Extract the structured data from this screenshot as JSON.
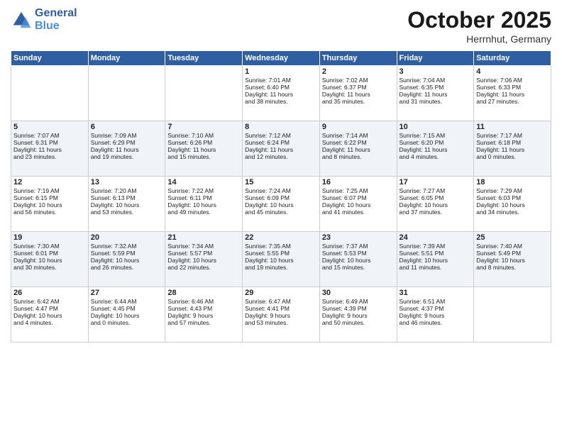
{
  "header": {
    "logo_line1": "General",
    "logo_line2": "Blue",
    "month": "October 2025",
    "location": "Herrnhut, Germany"
  },
  "days_of_week": [
    "Sunday",
    "Monday",
    "Tuesday",
    "Wednesday",
    "Thursday",
    "Friday",
    "Saturday"
  ],
  "weeks": [
    [
      {
        "day": "",
        "info": ""
      },
      {
        "day": "",
        "info": ""
      },
      {
        "day": "",
        "info": ""
      },
      {
        "day": "1",
        "info": "Sunrise: 7:01 AM\nSunset: 6:40 PM\nDaylight: 11 hours\nand 38 minutes."
      },
      {
        "day": "2",
        "info": "Sunrise: 7:02 AM\nSunset: 6:37 PM\nDaylight: 11 hours\nand 35 minutes."
      },
      {
        "day": "3",
        "info": "Sunrise: 7:04 AM\nSunset: 6:35 PM\nDaylight: 11 hours\nand 31 minutes."
      },
      {
        "day": "4",
        "info": "Sunrise: 7:06 AM\nSunset: 6:33 PM\nDaylight: 11 hours\nand 27 minutes."
      }
    ],
    [
      {
        "day": "5",
        "info": "Sunrise: 7:07 AM\nSunset: 6:31 PM\nDaylight: 11 hours\nand 23 minutes."
      },
      {
        "day": "6",
        "info": "Sunrise: 7:09 AM\nSunset: 6:29 PM\nDaylight: 11 hours\nand 19 minutes."
      },
      {
        "day": "7",
        "info": "Sunrise: 7:10 AM\nSunset: 6:26 PM\nDaylight: 11 hours\nand 15 minutes."
      },
      {
        "day": "8",
        "info": "Sunrise: 7:12 AM\nSunset: 6:24 PM\nDaylight: 11 hours\nand 12 minutes."
      },
      {
        "day": "9",
        "info": "Sunrise: 7:14 AM\nSunset: 6:22 PM\nDaylight: 11 hours\nand 8 minutes."
      },
      {
        "day": "10",
        "info": "Sunrise: 7:15 AM\nSunset: 6:20 PM\nDaylight: 11 hours\nand 4 minutes."
      },
      {
        "day": "11",
        "info": "Sunrise: 7:17 AM\nSunset: 6:18 PM\nDaylight: 11 hours\nand 0 minutes."
      }
    ],
    [
      {
        "day": "12",
        "info": "Sunrise: 7:19 AM\nSunset: 6:15 PM\nDaylight: 10 hours\nand 56 minutes."
      },
      {
        "day": "13",
        "info": "Sunrise: 7:20 AM\nSunset: 6:13 PM\nDaylight: 10 hours\nand 53 minutes."
      },
      {
        "day": "14",
        "info": "Sunrise: 7:22 AM\nSunset: 6:11 PM\nDaylight: 10 hours\nand 49 minutes."
      },
      {
        "day": "15",
        "info": "Sunrise: 7:24 AM\nSunset: 6:09 PM\nDaylight: 10 hours\nand 45 minutes."
      },
      {
        "day": "16",
        "info": "Sunrise: 7:25 AM\nSunset: 6:07 PM\nDaylight: 10 hours\nand 41 minutes."
      },
      {
        "day": "17",
        "info": "Sunrise: 7:27 AM\nSunset: 6:05 PM\nDaylight: 10 hours\nand 37 minutes."
      },
      {
        "day": "18",
        "info": "Sunrise: 7:29 AM\nSunset: 6:03 PM\nDaylight: 10 hours\nand 34 minutes."
      }
    ],
    [
      {
        "day": "19",
        "info": "Sunrise: 7:30 AM\nSunset: 6:01 PM\nDaylight: 10 hours\nand 30 minutes."
      },
      {
        "day": "20",
        "info": "Sunrise: 7:32 AM\nSunset: 5:59 PM\nDaylight: 10 hours\nand 26 minutes."
      },
      {
        "day": "21",
        "info": "Sunrise: 7:34 AM\nSunset: 5:57 PM\nDaylight: 10 hours\nand 22 minutes."
      },
      {
        "day": "22",
        "info": "Sunrise: 7:35 AM\nSunset: 5:55 PM\nDaylight: 10 hours\nand 19 minutes."
      },
      {
        "day": "23",
        "info": "Sunrise: 7:37 AM\nSunset: 5:53 PM\nDaylight: 10 hours\nand 15 minutes."
      },
      {
        "day": "24",
        "info": "Sunrise: 7:39 AM\nSunset: 5:51 PM\nDaylight: 10 hours\nand 11 minutes."
      },
      {
        "day": "25",
        "info": "Sunrise: 7:40 AM\nSunset: 5:49 PM\nDaylight: 10 hours\nand 8 minutes."
      }
    ],
    [
      {
        "day": "26",
        "info": "Sunrise: 6:42 AM\nSunset: 4:47 PM\nDaylight: 10 hours\nand 4 minutes."
      },
      {
        "day": "27",
        "info": "Sunrise: 6:44 AM\nSunset: 4:45 PM\nDaylight: 10 hours\nand 0 minutes."
      },
      {
        "day": "28",
        "info": "Sunrise: 6:46 AM\nSunset: 4:43 PM\nDaylight: 9 hours\nand 57 minutes."
      },
      {
        "day": "29",
        "info": "Sunrise: 6:47 AM\nSunset: 4:41 PM\nDaylight: 9 hours\nand 53 minutes."
      },
      {
        "day": "30",
        "info": "Sunrise: 6:49 AM\nSunset: 4:39 PM\nDaylight: 9 hours\nand 50 minutes."
      },
      {
        "day": "31",
        "info": "Sunrise: 6:51 AM\nSunset: 4:37 PM\nDaylight: 9 hours\nand 46 minutes."
      },
      {
        "day": "",
        "info": ""
      }
    ]
  ]
}
